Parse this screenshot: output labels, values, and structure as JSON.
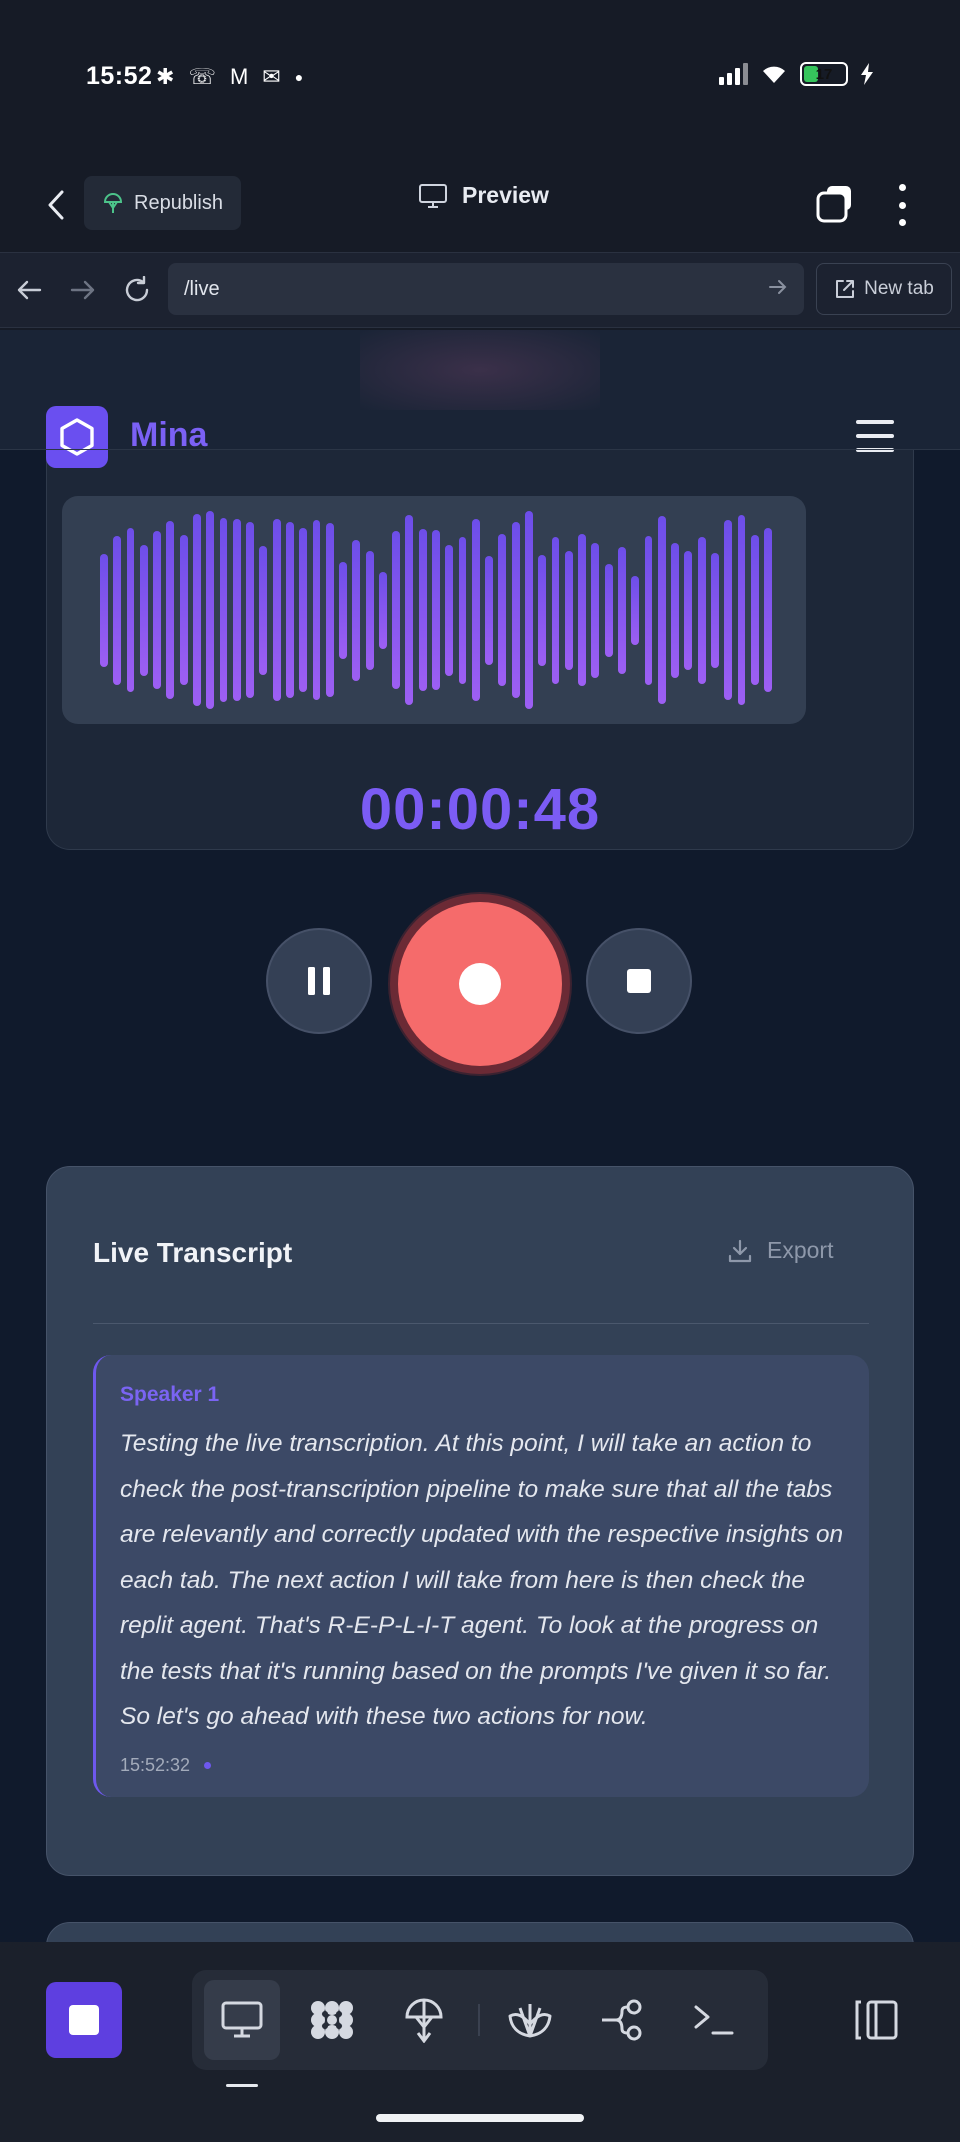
{
  "status_bar": {
    "time": "15:52",
    "battery": "17",
    "left_icons": [
      "slack-icon",
      "missed-call-icon",
      "gmail-icon",
      "mail-icon",
      "dot-icon"
    ],
    "right_icons": [
      "signal-icon",
      "wifi-icon",
      "battery-icon",
      "charging-icon"
    ]
  },
  "app_bar": {
    "republish_label": "Republish",
    "preview_label": "Preview"
  },
  "url_bar": {
    "url": "/live",
    "new_tab_label": "New tab"
  },
  "site": {
    "brand": "Mina"
  },
  "recorder": {
    "timer": "00:00:48",
    "waveform_levels": [
      0.57,
      0.75,
      0.83,
      0.66,
      0.8,
      0.9,
      0.76,
      0.97,
      1.0,
      0.93,
      0.92,
      0.89,
      0.65,
      0.92,
      0.89,
      0.83,
      0.91,
      0.88,
      0.49,
      0.71,
      0.6,
      0.39,
      0.8,
      0.96,
      0.82,
      0.81,
      0.66,
      0.74,
      0.92,
      0.55,
      0.77,
      0.89,
      1.0,
      0.56,
      0.74,
      0.6,
      0.77,
      0.68,
      0.47,
      0.64,
      0.35,
      0.75,
      0.95,
      0.68,
      0.6,
      0.74,
      0.58,
      0.91,
      0.96,
      0.76,
      0.83
    ]
  },
  "transcript": {
    "title": "Live Transcript",
    "export_label": "Export",
    "entries": [
      {
        "speaker": "Speaker 1",
        "text": "Testing the live transcription. At this point, I will take an action to check the post-transcription pipeline to make sure that all the tabs are relevantly and correctly updated with the respective insights on each tab. The next action I will take from here is then check the replit agent. That's R-E-P-L-I-T agent. To look at the progress on the tests that it's running based on the prompts I've given it so far. So let's go ahead with these two actions for now.",
        "time": "15:52:32"
      }
    ]
  },
  "toolbar": {
    "items": [
      "desktop-icon",
      "apps-icon",
      "deploy-icon",
      "shell-icon",
      "git-icon",
      "console-icon"
    ],
    "active": "desktop-icon"
  },
  "colors": {
    "accent": "#7b5cf4",
    "record": "#f56b6b",
    "background": "#101a2c",
    "card": "#334156"
  }
}
